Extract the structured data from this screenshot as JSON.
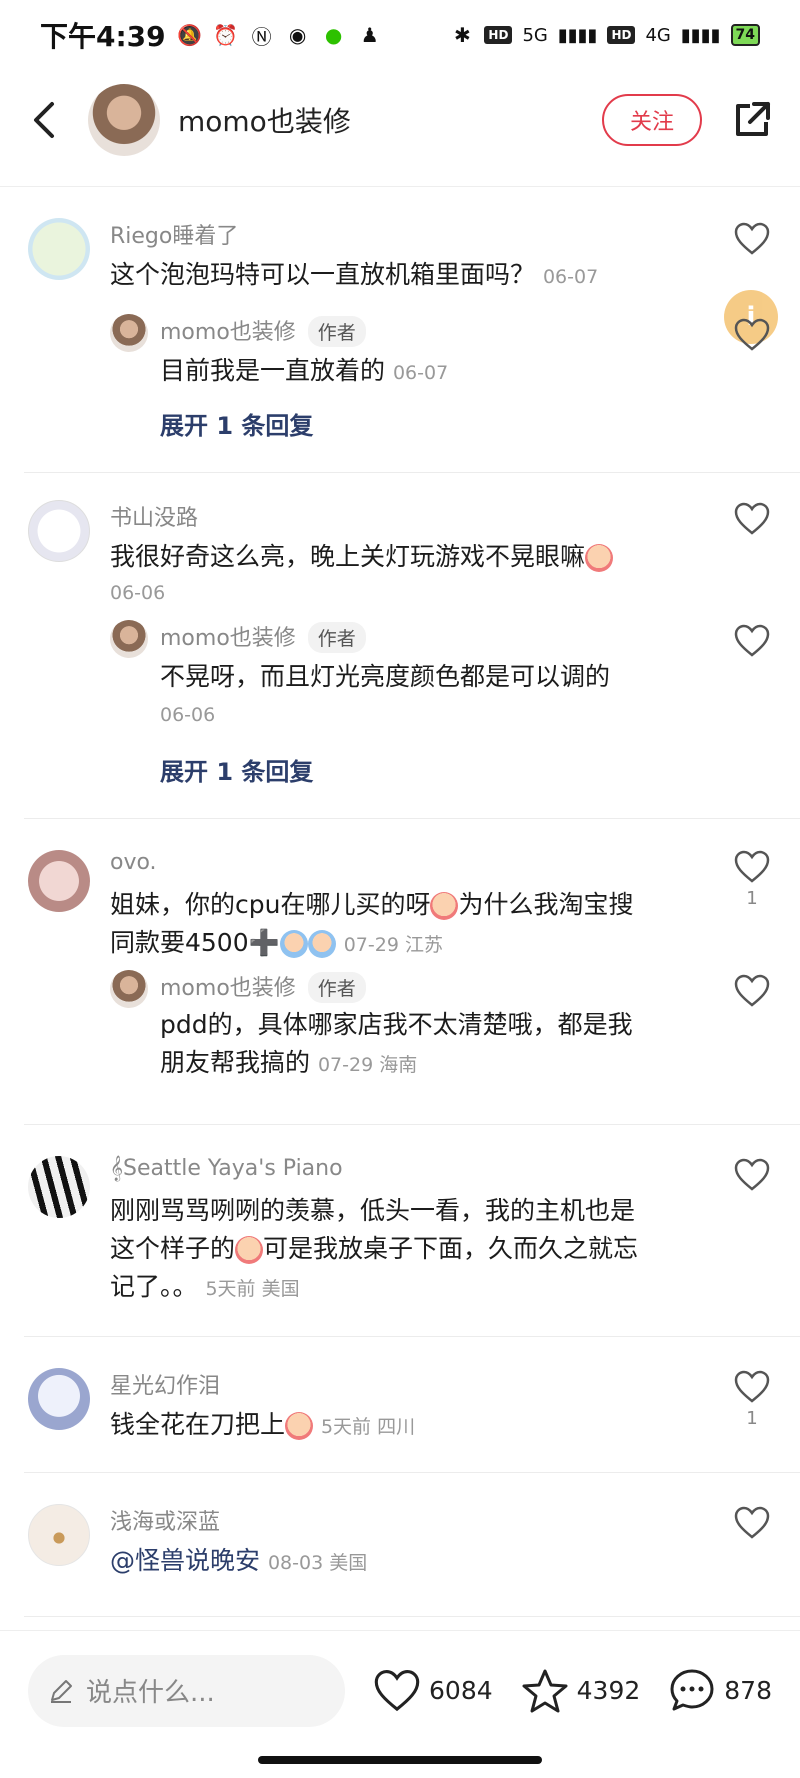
{
  "status_bar": {
    "time": "下午4:39",
    "network_1": "5G",
    "network_2": "4G",
    "hd": "HD",
    "battery": "74"
  },
  "header": {
    "author_name": "momo也装修",
    "follow_label": "关注"
  },
  "comments": [
    {
      "user": "Riego睡着了",
      "text": "这个泡泡玛特可以一直放机箱里面吗？",
      "meta": "06-07",
      "reply": {
        "user": "momo也装修",
        "tag": "作者",
        "text": "目前我是一直放着的",
        "meta": "06-07",
        "expand": "展开 1 条回复"
      }
    },
    {
      "user": "书山没路",
      "text": "我很好奇这么亮，晚上关灯玩游戏不晃眼嘛",
      "meta": "06-06",
      "reply": {
        "user": "momo也装修",
        "tag": "作者",
        "text": "不晃呀，而且灯光亮度颜色都是可以调的",
        "meta": "06-06",
        "expand": "展开 1 条回复"
      }
    },
    {
      "user": "ovo.",
      "text_line1": "姐妹，你的cpu在哪儿买的呀",
      "text_line1b": "为什么我淘宝搜",
      "text_line2": "同款要4500➕",
      "meta": "07-29 江苏",
      "likes": "1",
      "reply": {
        "user": "momo也装修",
        "tag": "作者",
        "text_line1": "pdd的，具体哪家店我不太清楚哦，都是我",
        "text_line2": "朋友帮我搞的",
        "meta": "07-29 海南"
      }
    },
    {
      "user": "Seattle Yaya's Piano",
      "text_line1": "刚刚骂骂咧咧的羡慕，低头一看，我的主机也是",
      "text_line2a": "这个样子的",
      "text_line2b": "可是我放桌子下面，久而久之就忘",
      "text_line3": "记了。。",
      "meta": "5天前 美国"
    },
    {
      "user": "星光幻作泪",
      "text": "钱全花在刀把上",
      "meta": "5天前 四川",
      "likes": "1"
    },
    {
      "user": "浅海或深蓝",
      "text": "@怪兽说晚安",
      "meta": "08-03 美国"
    }
  ],
  "bottom_bar": {
    "input_placeholder": "说点什么...",
    "likes": "6084",
    "favorites": "4392",
    "comments": "878"
  },
  "colors": {
    "accent": "#e23b4b",
    "link": "#2c3e6b"
  }
}
